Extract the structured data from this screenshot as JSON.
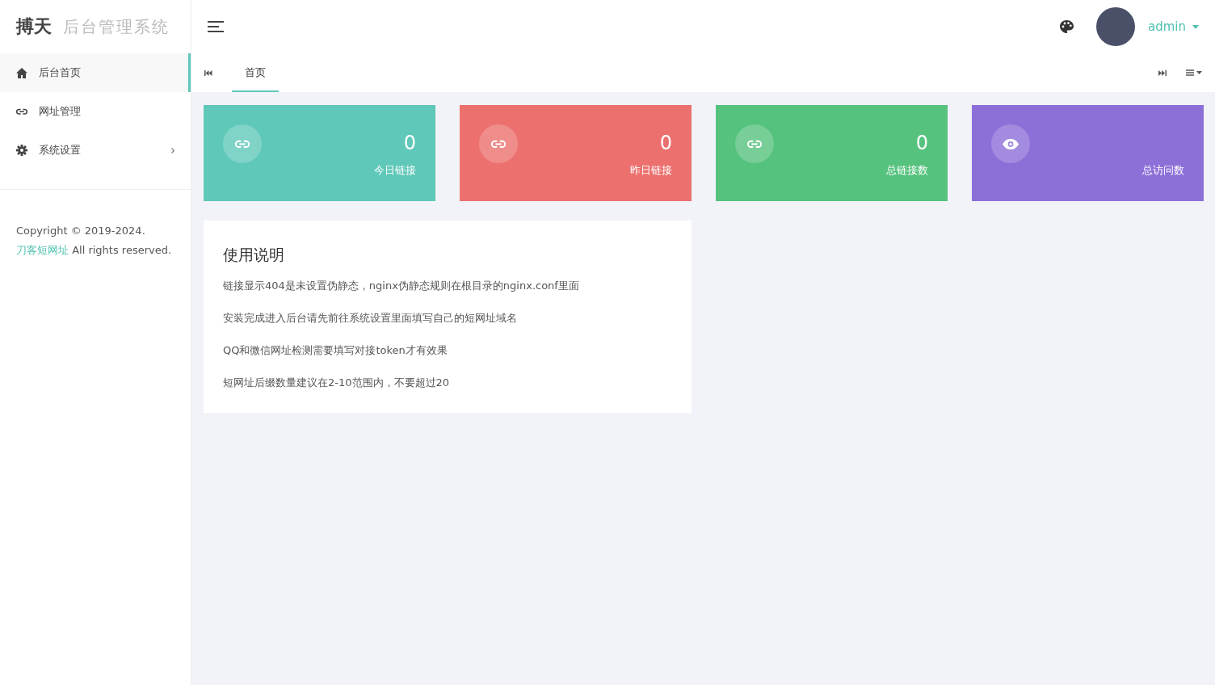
{
  "brand": {
    "logo": "搏天",
    "subtitle": "后台管理系统"
  },
  "sidebar": {
    "items": [
      {
        "label": "后台首页",
        "kind": "link",
        "selected": true
      },
      {
        "label": "网址管理",
        "kind": "link",
        "selected": false
      },
      {
        "label": "系统设置",
        "kind": "submenu",
        "selected": false
      }
    ],
    "copyright": {
      "before": "Copyright © 2019-2024. ",
      "link": "刀客短网址",
      "after": " All rights reserved."
    }
  },
  "header": {
    "user": "admin"
  },
  "tabs": [
    {
      "label": "首页",
      "selected": true
    }
  ],
  "stats": [
    {
      "kind": "links",
      "value": "0",
      "label": "今日链接",
      "color": "#5fc8b9"
    },
    {
      "kind": "links",
      "value": "0",
      "label": "昨日链接",
      "color": "#ec716e"
    },
    {
      "kind": "links",
      "value": "0",
      "label": "总链接数",
      "color": "#55c27d"
    },
    {
      "kind": "views",
      "label": "总访问数",
      "color": "#8d6fd8"
    }
  ],
  "notice": {
    "title": "使用说明",
    "lines": [
      "链接显示404是未设置伪静态，nginx伪静态规则在根目录的nginx.conf里面",
      "安装完成进入后台请先前往系统设置里面填写自己的短网址域名",
      "QQ和微信网址检测需要填写对接token才有效果",
      "短网址后缀数量建议在2-10范围内，不要超过20"
    ]
  }
}
